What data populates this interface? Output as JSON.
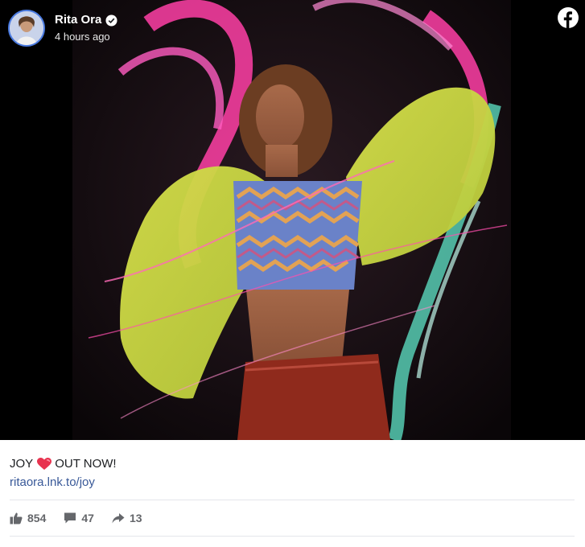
{
  "post": {
    "author": "Rita Ora",
    "timestamp": "4 hours ago",
    "caption_before": "JOY",
    "caption_after": "OUT NOW!",
    "link": "ritaora.lnk.to/joy"
  },
  "stats": {
    "likes": "854",
    "comments": "47",
    "shares": "13"
  },
  "icons": {
    "platform": "facebook-icon",
    "verified": "verified-badge-icon",
    "heart": "heart-icon",
    "like": "thumbs-up-icon",
    "comment": "comment-icon",
    "share": "share-arrow-icon"
  },
  "colors": {
    "link": "#385898",
    "stats_text": "#65676b",
    "verified_badge": "#ffffff",
    "heart": "#e8334f"
  }
}
